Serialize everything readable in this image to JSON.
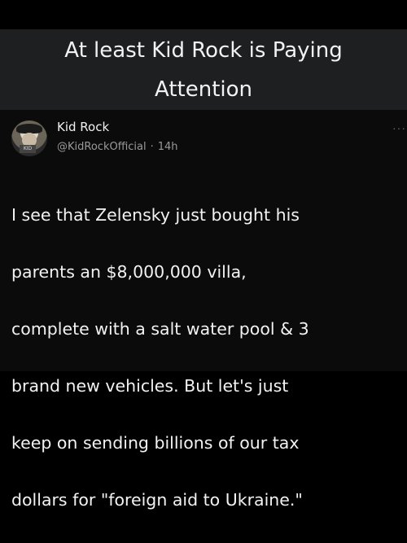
{
  "caption": {
    "line1": "At least Kid Rock is Paying",
    "line2": "Attention"
  },
  "post": {
    "display_name": "Kid Rock",
    "handle": "@KidRockOfficial",
    "separator": "·",
    "time_ago": "14h",
    "more_icon": "more-dots-icon",
    "avatar_badge": "KID",
    "text_lines": [
      "I see that Zelensky just bought his",
      "parents an $8,000,000 villa,",
      "complete with a salt water pool & 3",
      "brand new vehicles. But let's just",
      "keep on sending billions of our tax",
      "dollars for \"foreign aid to Ukraine.\""
    ]
  }
}
